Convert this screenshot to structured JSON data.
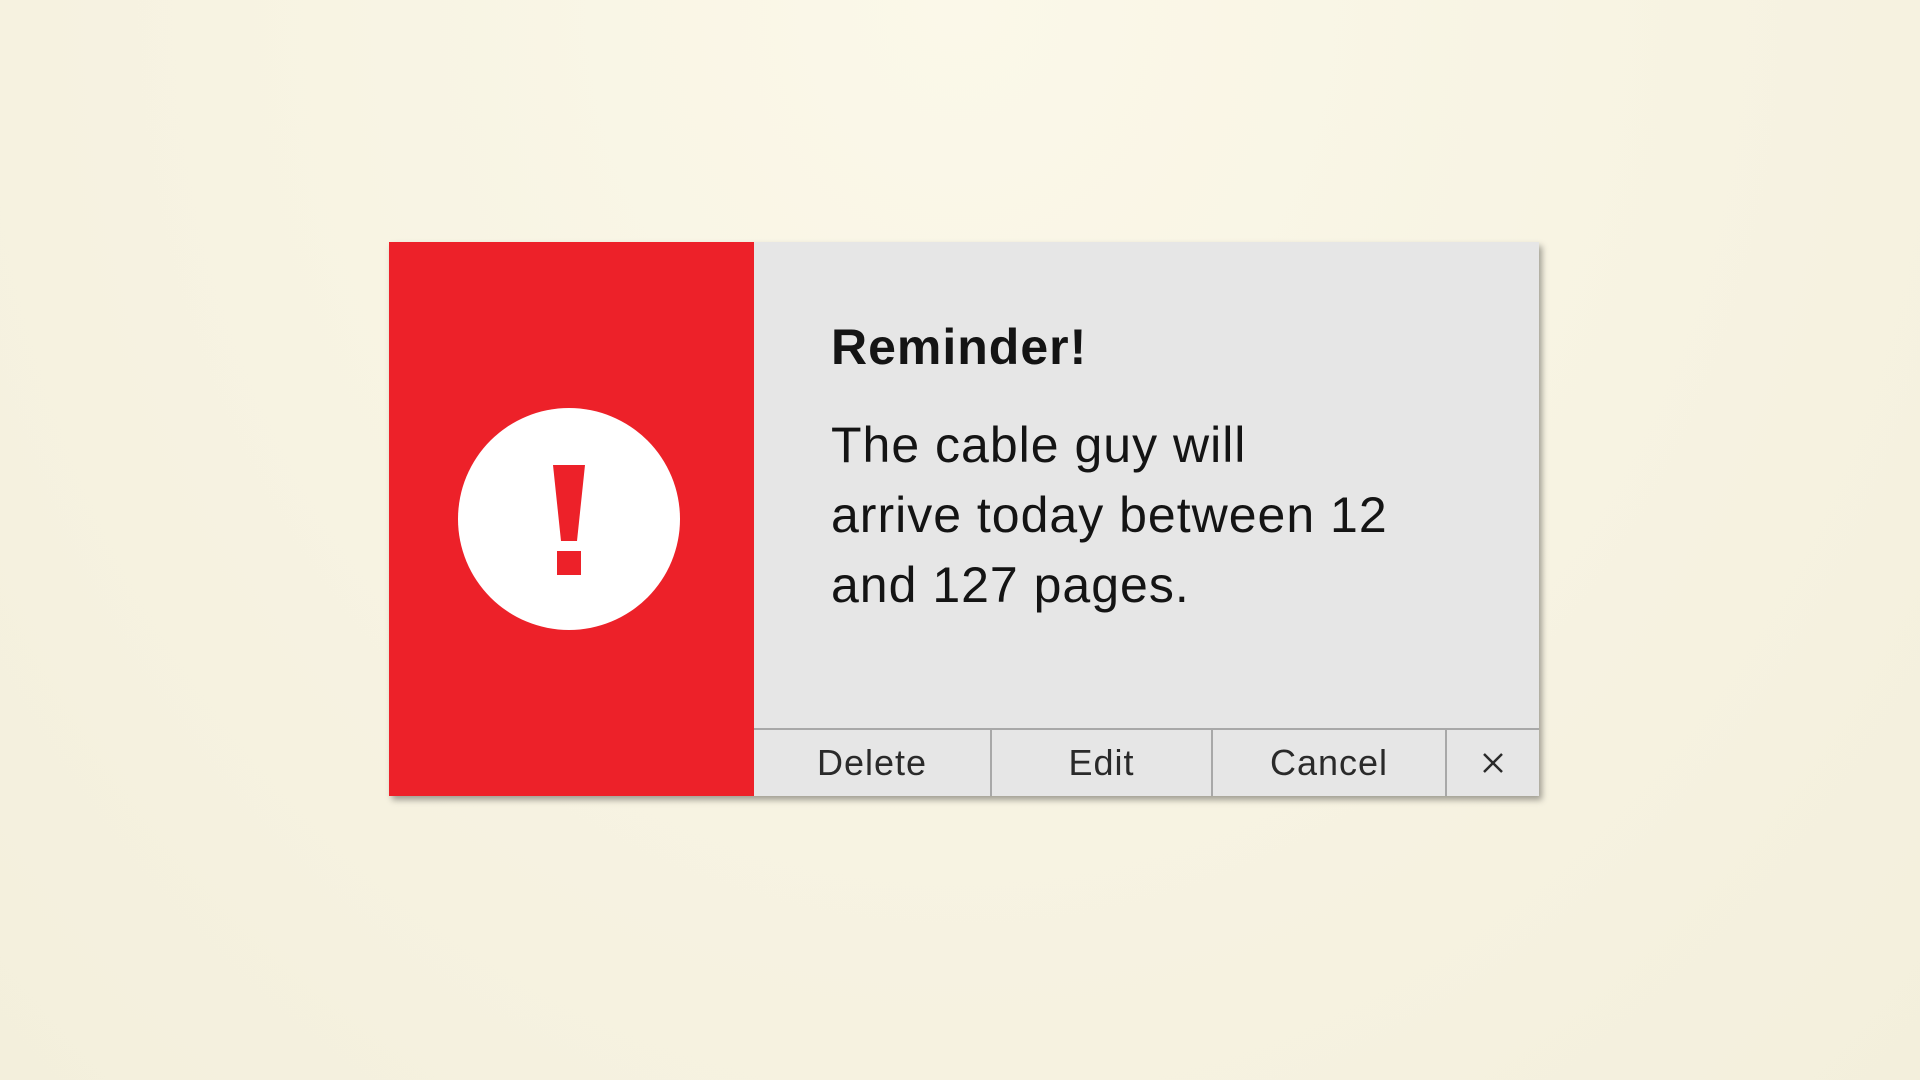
{
  "dialog": {
    "title": "Reminder!",
    "message": "The cable guy will arrive today between 12 and 127 pages.",
    "icon": "exclamation-icon",
    "accent_color": "#ed2129",
    "panel_color": "#e6e6e6"
  },
  "buttons": {
    "delete": "Delete",
    "edit": "Edit",
    "cancel": "Cancel",
    "close_icon": "close-icon"
  }
}
